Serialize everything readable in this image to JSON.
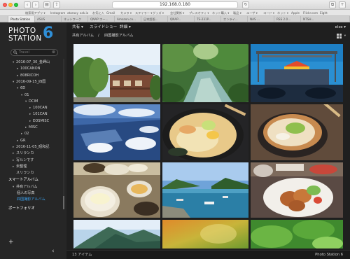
{
  "browser": {
    "url": "192.168.0.180",
    "bookmarks": [
      "検索用アプリ ▾",
      "Instagram",
      "ataraxy",
      "ask.io",
      "お気に入",
      "Gmail",
      "カメラ ▾",
      "ステイラー ▾",
      "グッズ ▾",
      "会社関係 ▾",
      "プレスオフィ ▾",
      "ネット購入 ▾",
      "製品 ▾",
      "ユーザ ▾",
      "コード ▾",
      "ネット ▾",
      "Apple",
      "Flickr.com",
      "Eight"
    ],
    "tabs": [
      "Photo Station",
      "ASUS",
      "ネットワーク",
      "QNAP ホー...",
      "Amazon.co...",
      "日本語版...",
      "QNAP...",
      "TS-231P...",
      "オンライ...",
      "NAS ...",
      "RSS 2.0...",
      "NTSH..."
    ]
  },
  "sidebar": {
    "logo_text_1": "PHOTO",
    "logo_text_2": "STATION",
    "logo_number": "6",
    "search_placeholder": "Travel",
    "tree": [
      {
        "label": "2016-07_30_金岬山",
        "arrow": "▾",
        "indent": 1
      },
      {
        "label": "100CANON",
        "arrow": "▸",
        "indent": 2
      },
      {
        "label": "808RICOH",
        "arrow": "▸",
        "indent": 2
      },
      {
        "label": "2016-09-15_四国",
        "arrow": "▾",
        "indent": 1
      },
      {
        "label": "6D",
        "arrow": "▾",
        "indent": 2
      },
      {
        "label": "01",
        "arrow": "▾",
        "indent": 3
      },
      {
        "label": "DCIM",
        "arrow": "▾",
        "indent": 4
      },
      {
        "label": "100CAN",
        "arrow": "▸",
        "indent": 5
      },
      {
        "label": "101CAN",
        "arrow": "▸",
        "indent": 5
      },
      {
        "label": "EOSMISC",
        "arrow": "▸",
        "indent": 5
      },
      {
        "label": "MISC",
        "arrow": "▸",
        "indent": 4
      },
      {
        "label": "02",
        "arrow": "▸",
        "indent": 3
      },
      {
        "label": "GR",
        "arrow": "▸",
        "indent": 2
      },
      {
        "label": "2016-11-05_昭和記",
        "arrow": "▸",
        "indent": 1
      },
      {
        "label": "スリランカ",
        "arrow": "▸",
        "indent": 1
      },
      {
        "label": "写ルンです",
        "arrow": "▸",
        "indent": 1
      },
      {
        "label": "未整理",
        "arrow": "▸",
        "indent": 1
      },
      {
        "label": "スリランカ",
        "arrow": "",
        "indent": 1
      }
    ],
    "smart_album": "スマートアルバム",
    "shared_album": "共有アルバム",
    "personal_photos": "個人の写真",
    "selected_album": "四国撮影アルバム",
    "portfolio": "ポートフォリオ",
    "add": "+",
    "collapse": "‹"
  },
  "main": {
    "nav": [
      "共有 ▾",
      "スライドショー",
      "詳細 ▾"
    ],
    "user": "else ▾",
    "breadcrumb": [
      "共有アルバム",
      "/",
      "四国撮影アルバム"
    ],
    "item_count": "13 アイテム",
    "brand": "Photo Station 6"
  },
  "photos": [
    {
      "name": "house-photo"
    },
    {
      "name": "river-photo"
    },
    {
      "name": "stage-photo"
    },
    {
      "name": "aerial-photo"
    },
    {
      "name": "udon-photo"
    },
    {
      "name": "udon-bowl-photo"
    },
    {
      "name": "rice-set-photo"
    },
    {
      "name": "harbor-photo"
    },
    {
      "name": "karaage-photo"
    },
    {
      "name": "mountain-photo"
    },
    {
      "name": "blur-photo"
    },
    {
      "name": "leaves-photo"
    }
  ]
}
